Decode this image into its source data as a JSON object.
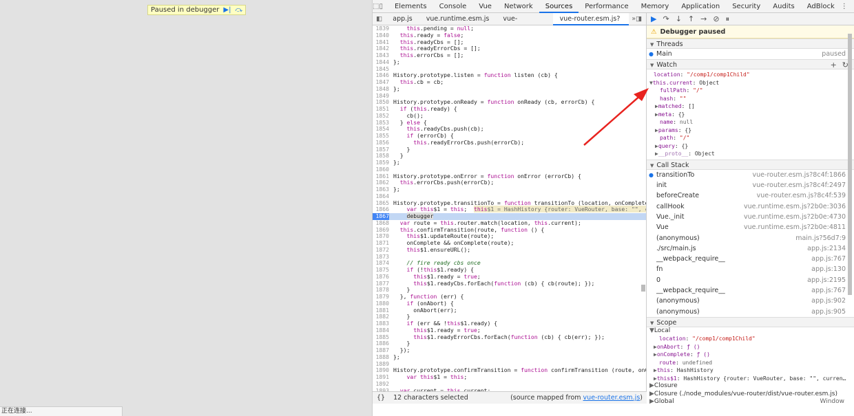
{
  "page": {
    "paused_badge": "Paused in debugger",
    "status_text": "正在连接..."
  },
  "devtools": {
    "tabs": [
      "Elements",
      "Console",
      "Vue",
      "Network",
      "Sources",
      "Performance",
      "Memory",
      "Application",
      "Security",
      "Audits",
      "AdBlock"
    ],
    "active_tab": "Sources",
    "file_tabs": [
      "app.js",
      "vue.runtime.esm.js",
      "vue-router.esm.js",
      "vue-router.esm.js?8c4f"
    ],
    "active_file_tab": "vue-router.esm.js?8c4f",
    "code_lines": [
      {
        "n": "1839",
        "t": "    this.pending = null;"
      },
      {
        "n": "1840",
        "t": "  this.ready = false;"
      },
      {
        "n": "1841",
        "t": "  this.readyCbs = [];"
      },
      {
        "n": "1842",
        "t": "  this.readyErrorCbs = [];"
      },
      {
        "n": "1843",
        "t": "  this.errorCbs = [];"
      },
      {
        "n": "1844",
        "t": "};"
      },
      {
        "n": "1845",
        "t": ""
      },
      {
        "n": "1846",
        "t": "History.prototype.listen = function listen (cb) {"
      },
      {
        "n": "1847",
        "t": "  this.cb = cb;"
      },
      {
        "n": "1848",
        "t": "};"
      },
      {
        "n": "1849",
        "t": ""
      },
      {
        "n": "1850",
        "t": "History.prototype.onReady = function onReady (cb, errorCb) {"
      },
      {
        "n": "1851",
        "t": "  if (this.ready) {"
      },
      {
        "n": "1852",
        "t": "    cb();"
      },
      {
        "n": "1853",
        "t": "  } else {"
      },
      {
        "n": "1854",
        "t": "    this.readyCbs.push(cb);"
      },
      {
        "n": "1855",
        "t": "    if (errorCb) {"
      },
      {
        "n": "1856",
        "t": "      this.readyErrorCbs.push(errorCb);"
      },
      {
        "n": "1857",
        "t": "    }"
      },
      {
        "n": "1858",
        "t": "  }"
      },
      {
        "n": "1859",
        "t": "};"
      },
      {
        "n": "1860",
        "t": ""
      },
      {
        "n": "1861",
        "t": "History.prototype.onError = function onError (errorCb) {"
      },
      {
        "n": "1862",
        "t": "  this.errorCbs.push(errorCb);"
      },
      {
        "n": "1863",
        "t": "};"
      },
      {
        "n": "1864",
        "t": ""
      },
      {
        "n": "1865",
        "t": "History.prototype.transitionTo = function transitionTo (location, onComplete,"
      },
      {
        "n": "1866",
        "t": "    var this$1 = this;  this$1 = HashHistory {router: VueRouter, base: \"\", c"
      },
      {
        "n": "1867",
        "t": "    debugger"
      },
      {
        "n": "1868",
        "t": "  var route = this.router.match(location, this.current);"
      },
      {
        "n": "1869",
        "t": "  this.confirmTransition(route, function () {"
      },
      {
        "n": "1870",
        "t": "    this$1.updateRoute(route);"
      },
      {
        "n": "1871",
        "t": "    onComplete && onComplete(route);"
      },
      {
        "n": "1872",
        "t": "    this$1.ensureURL();"
      },
      {
        "n": "1873",
        "t": ""
      },
      {
        "n": "1874",
        "t": "    // fire ready cbs once"
      },
      {
        "n": "1875",
        "t": "    if (!this$1.ready) {"
      },
      {
        "n": "1876",
        "t": "      this$1.ready = true;"
      },
      {
        "n": "1877",
        "t": "      this$1.readyCbs.forEach(function (cb) { cb(route); });"
      },
      {
        "n": "1878",
        "t": "    }"
      },
      {
        "n": "1879",
        "t": "  }, function (err) {"
      },
      {
        "n": "1880",
        "t": "    if (onAbort) {"
      },
      {
        "n": "1881",
        "t": "      onAbort(err);"
      },
      {
        "n": "1882",
        "t": "    }"
      },
      {
        "n": "1883",
        "t": "    if (err && !this$1.ready) {"
      },
      {
        "n": "1884",
        "t": "      this$1.ready = true;"
      },
      {
        "n": "1885",
        "t": "      this$1.readyErrorCbs.forEach(function (cb) { cb(err); });"
      },
      {
        "n": "1886",
        "t": "    }"
      },
      {
        "n": "1887",
        "t": "  });"
      },
      {
        "n": "1888",
        "t": "};"
      },
      {
        "n": "1889",
        "t": ""
      },
      {
        "n": "1890",
        "t": "History.prototype.confirmTransition = function confirmTransition (route, onCo"
      },
      {
        "n": "1891",
        "t": "    var this$1 = this;"
      },
      {
        "n": "1892",
        "t": ""
      },
      {
        "n": "1893",
        "t": "  var current = this.current;"
      },
      {
        "n": "1894",
        "t": "  var abort = function (err) {"
      }
    ],
    "exec_line": "1867",
    "status_left_icon": "{}",
    "status_selection": "12 characters selected",
    "status_mapped_prefix": "(source mapped from",
    "status_mapped_file": "vue-router.esm.js",
    "status_mapped_suffix": ")",
    "paused_banner": "Debugger paused",
    "threads": {
      "title": "Threads",
      "items": [
        {
          "name": "Main",
          "state": "paused"
        }
      ]
    },
    "watch": {
      "title": "Watch",
      "location_expr": "location",
      "location_val": "\"/comp1/comp1Child\"",
      "current_expr": "this.current",
      "current_val": "Object",
      "props": [
        {
          "k": "fullPath",
          "v": "\"/\"",
          "exp": false
        },
        {
          "k": "hash",
          "v": "\"\"",
          "exp": false
        },
        {
          "k": "matched",
          "v": "[]",
          "exp": true
        },
        {
          "k": "meta",
          "v": "{}",
          "exp": true
        },
        {
          "k": "name",
          "v": "null",
          "exp": false
        },
        {
          "k": "params",
          "v": "{}",
          "exp": true
        },
        {
          "k": "path",
          "v": "\"/\"",
          "exp": false
        },
        {
          "k": "query",
          "v": "{}",
          "exp": true
        },
        {
          "k": "__proto__",
          "v": "Object",
          "exp": true
        }
      ]
    },
    "callstack": {
      "title": "Call Stack",
      "frames": [
        {
          "fn": "transitionTo",
          "loc": "vue-router.esm.js?8c4f:1866"
        },
        {
          "fn": "init",
          "loc": "vue-router.esm.js?8c4f:2497"
        },
        {
          "fn": "beforeCreate",
          "loc": "vue-router.esm.js?8c4f:539"
        },
        {
          "fn": "callHook",
          "loc": "vue.runtime.esm.js?2b0e:3036"
        },
        {
          "fn": "Vue._init",
          "loc": "vue.runtime.esm.js?2b0e:4730"
        },
        {
          "fn": "Vue",
          "loc": "vue.runtime.esm.js?2b0e:4811"
        },
        {
          "fn": "(anonymous)",
          "loc": "main.js?56d7:9"
        },
        {
          "fn": "./src/main.js",
          "loc": "app.js:2134"
        },
        {
          "fn": "__webpack_require__",
          "loc": "app.js:767"
        },
        {
          "fn": "fn",
          "loc": "app.js:130"
        },
        {
          "fn": "0",
          "loc": "app.js:2195"
        },
        {
          "fn": "__webpack_require__",
          "loc": "app.js:767"
        },
        {
          "fn": "(anonymous)",
          "loc": "app.js:902"
        },
        {
          "fn": "(anonymous)",
          "loc": "app.js:905"
        }
      ]
    },
    "scope": {
      "title": "Scope",
      "local": "Local",
      "local_items": [
        {
          "k": "location",
          "v": "\"/comp1/comp1Child\"",
          "exp": false
        },
        {
          "k": "onAbort",
          "v": "ƒ ()",
          "exp": true
        },
        {
          "k": "onComplete",
          "v": "ƒ ()",
          "exp": true
        },
        {
          "k": "route",
          "v": "undefined",
          "exp": false
        },
        {
          "k": "this",
          "v": "HashHistory",
          "exp": true
        },
        {
          "k": "this$1",
          "v": "HashHistory {router: VueRouter, base: \"\", curren…",
          "exp": true
        }
      ],
      "closure": "Closure",
      "closure2": "Closure (./node_modules/vue-router/dist/vue-router.esm.js)",
      "global": "Global",
      "global_val": "Window"
    }
  }
}
